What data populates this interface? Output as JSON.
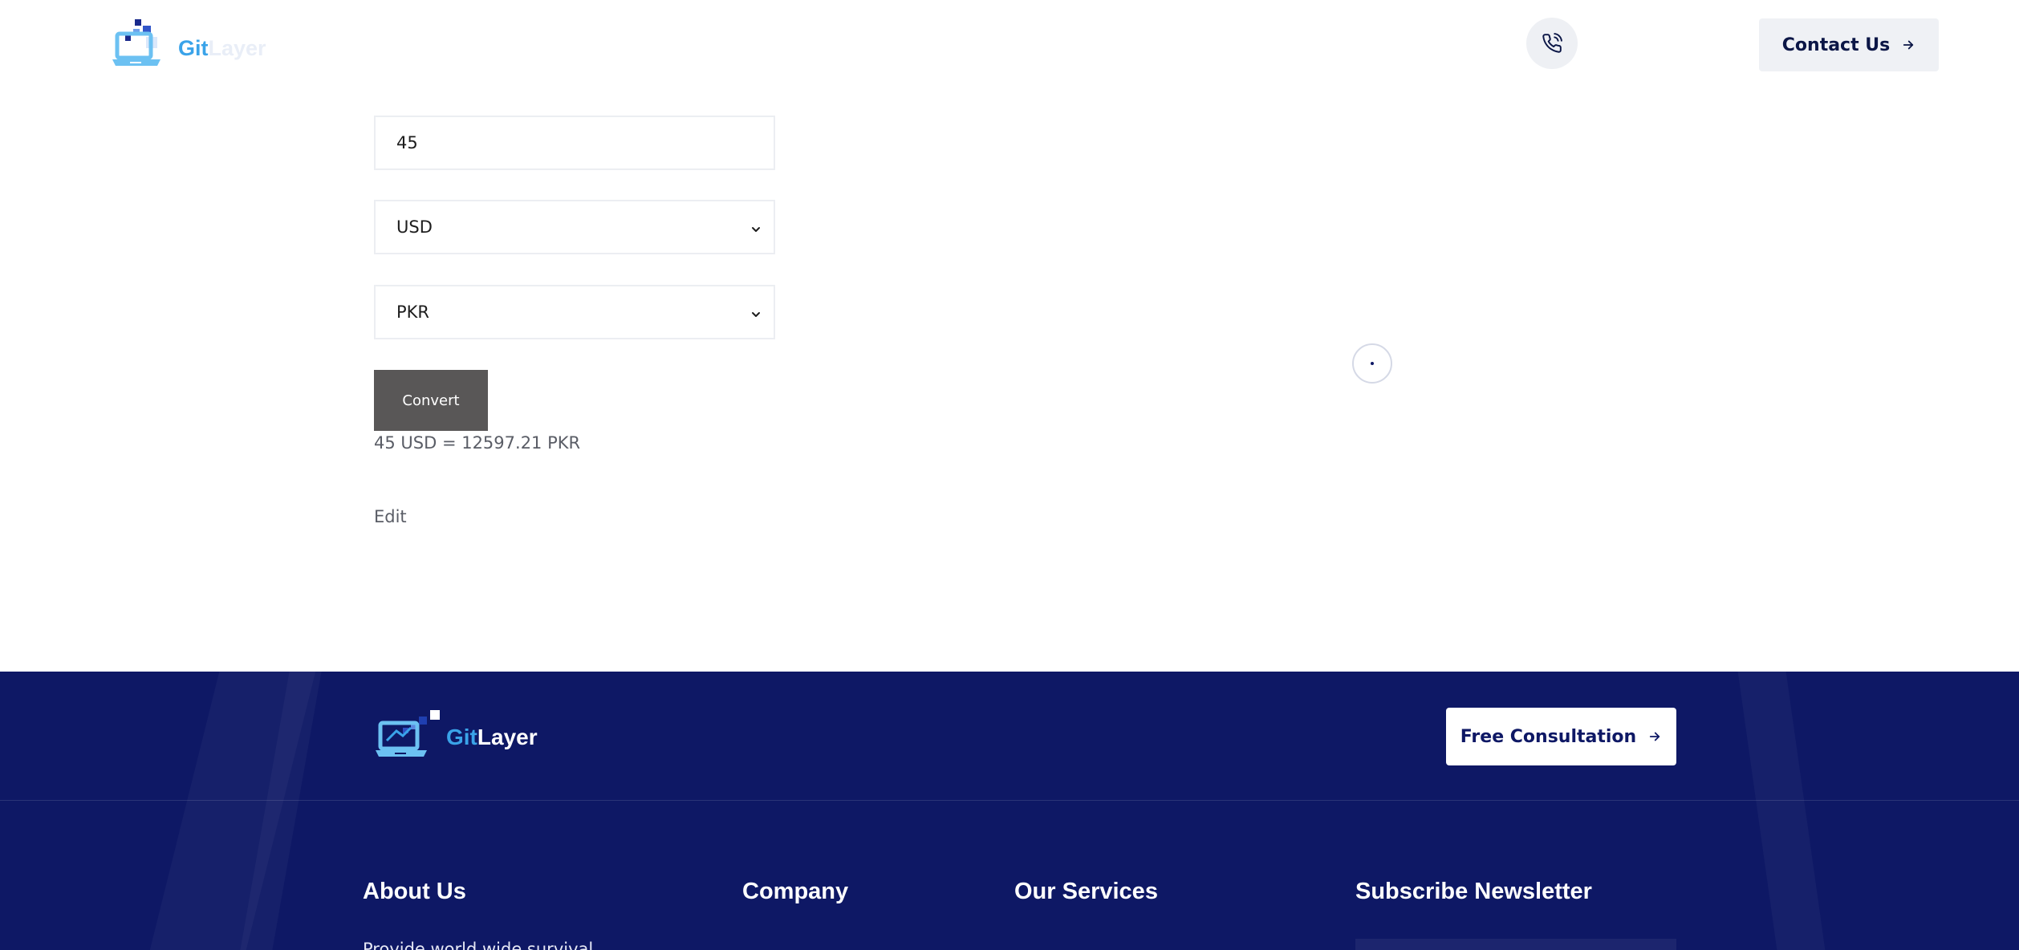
{
  "header": {
    "logo_text_visible": "Git",
    "logo_text_faded": "Layer",
    "phone_icon": "phone-icon",
    "contact_label": "Contact Us",
    "contact_icon": "arrow-right-icon"
  },
  "converter": {
    "amount_value": "45",
    "from_currency": "USD",
    "to_currency": "PKR",
    "convert_label": "Convert",
    "result_text": "45 USD = 12597.21 PKR",
    "edit_label": "Edit"
  },
  "loader": {
    "icon": "loading-spinner-icon"
  },
  "footer": {
    "logo_git": "Git",
    "logo_layer": "Layer",
    "consultation_label": "Free Consultation",
    "consultation_icon": "arrow-right-icon",
    "columns": {
      "about_title": "About Us",
      "company_title": "Company",
      "services_title": "Our Services",
      "newsletter_title": "Subscribe Newsletter"
    },
    "about_text": "Provide world wide survival"
  },
  "colors": {
    "brand_navy": "#0e1865",
    "brand_blue": "#3aa3e9",
    "button_gray": "#595757",
    "light_button_bg": "#eff1f5"
  }
}
